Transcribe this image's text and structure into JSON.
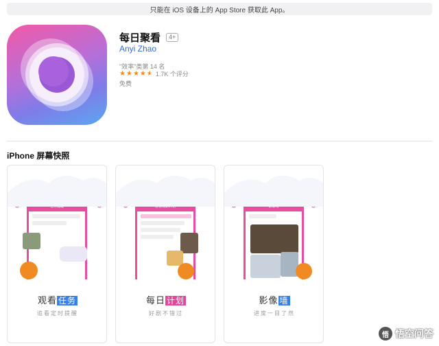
{
  "banner": {
    "text": "只能在 iOS 设备上的 App Store 获取此 App。"
  },
  "app": {
    "title": "每日聚看",
    "age_rating": "4+",
    "developer": "Anyi Zhao",
    "rank": "\"效率\"类第 14 名",
    "rating": 4.5,
    "rating_text": "1.7K 个评分",
    "price": "免费"
  },
  "section": {
    "title": "iPhone 屏幕快照"
  },
  "screenshots": [
    {
      "caption_plain": "观看",
      "caption_highlight": "任务",
      "subtitle": "追看定时提醒",
      "phone_header": "任务提醒"
    },
    {
      "caption_plain": "每日",
      "caption_highlight": "计划",
      "subtitle": "好剧不错过",
      "phone_header": "追看观影计划"
    },
    {
      "caption_plain": "影像",
      "caption_highlight": "墙",
      "subtitle": "进度一目了然",
      "phone_header": "影像墙"
    }
  ],
  "watermark": {
    "text": "悟空问答",
    "icon": "wukong-icon"
  },
  "colors": {
    "accent_blue": "#2f6bd8",
    "star": "#ef8a1e",
    "brand_pink": "#e64da0",
    "tag_blue": "#3a7ee8"
  }
}
